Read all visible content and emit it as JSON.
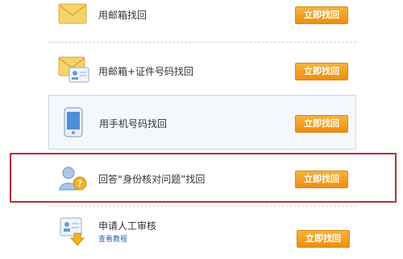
{
  "options": [
    {
      "label": "用邮箱找回",
      "button": "立即找回",
      "icon": "mail-icon"
    },
    {
      "label": "用邮箱+证件号码找回",
      "button": "立即找回",
      "icon": "mail-id-card-icon"
    },
    {
      "label": "用手机号码找回",
      "button": "立即找回",
      "icon": "phone-icon"
    },
    {
      "label": "回答“身份核对问题”找回",
      "button": "立即找回",
      "icon": "user-question-icon"
    },
    {
      "label": "申请人工审核",
      "sub_link": "查看教程",
      "button": "立即找回",
      "icon": "manual-review-icon"
    }
  ],
  "colors": {
    "button": "#f0a020",
    "highlight": "#b5303a",
    "selected_row_bg": "#f4f8fc",
    "link": "#2a64b8"
  }
}
